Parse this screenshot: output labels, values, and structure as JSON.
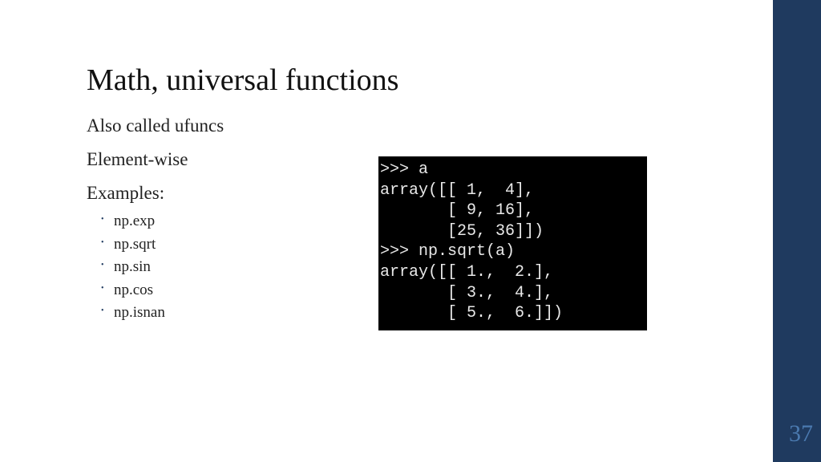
{
  "slide": {
    "title": "Math, universal functions",
    "subtitle1": "Also called ufuncs",
    "subtitle2": "Element-wise",
    "examples_label": "Examples:",
    "examples": [
      "np.exp",
      "np.sqrt",
      "np.sin",
      "np.cos",
      "np.isnan"
    ],
    "page_number": "37"
  },
  "terminal": {
    "lines": ">>> a\narray([[ 1,  4],\n       [ 9, 16],\n       [25, 36]])\n>>> np.sqrt(a)\narray([[ 1.,  2.],\n       [ 3.,  4.],\n       [ 5.,  6.]])"
  }
}
